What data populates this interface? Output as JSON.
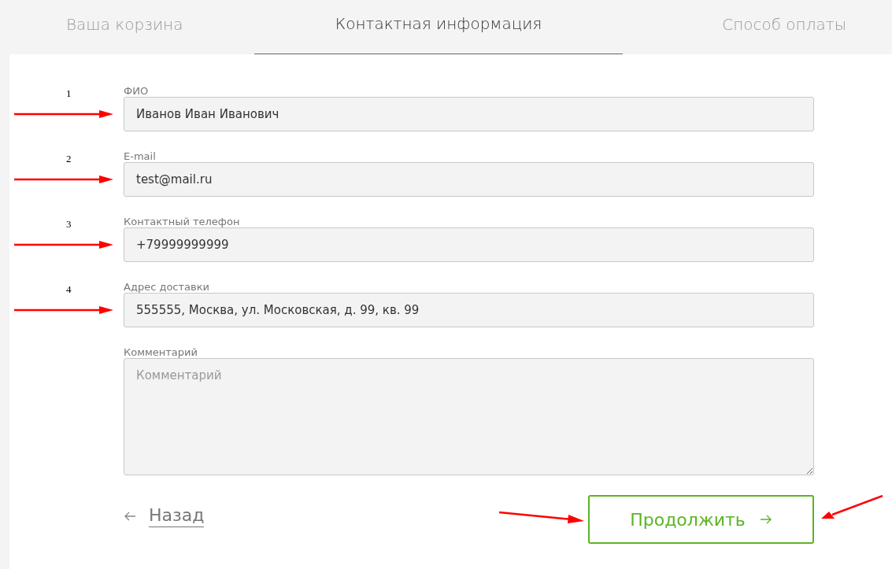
{
  "tabs": [
    {
      "label": "Ваша корзина",
      "selected": false
    },
    {
      "label": "Контактная информация",
      "selected": true
    },
    {
      "label": "Способ оплаты",
      "selected": false
    }
  ],
  "fields": [
    {
      "kind": "input",
      "label": "ФИО",
      "value": "Иванов Иван Иванович",
      "annotation": "1"
    },
    {
      "kind": "input",
      "label": "E-mail",
      "value": "test@mail.ru",
      "annotation": "2"
    },
    {
      "kind": "input",
      "label": "Контактный телефон",
      "value": "+79999999999",
      "annotation": "3"
    },
    {
      "kind": "input",
      "label": "Адрес доставки",
      "value": "555555, Москва, ул. Московская, д. 99, кв. 99",
      "annotation": "4"
    },
    {
      "kind": "textarea",
      "label": "Комментарий",
      "placeholder": "Комментарий"
    }
  ],
  "back_link": "Назад",
  "continue_button": "Продолжить"
}
